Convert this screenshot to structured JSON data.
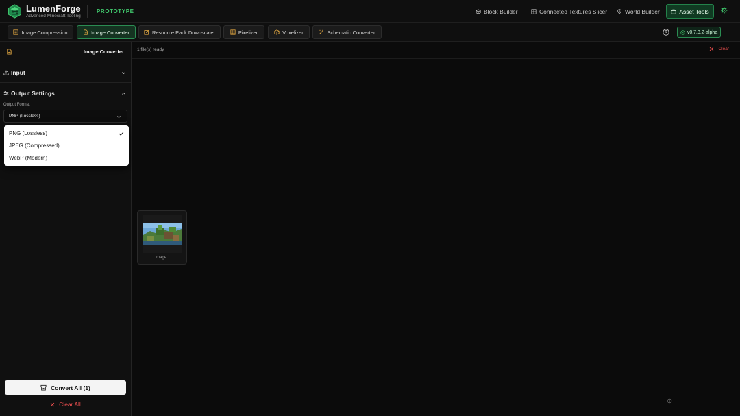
{
  "app": {
    "name": "LumenForge",
    "subtitle": "Advanced Minecraft Tooling",
    "badge": "PROTOTYPE",
    "accent_color": "#3fc36a"
  },
  "top_nav": {
    "links": [
      {
        "label": "Block Builder",
        "icon": "cube-stack-icon"
      },
      {
        "label": "Connected Textures Slicer",
        "icon": "grid-icon"
      },
      {
        "label": "World Builder",
        "icon": "map-pin-icon"
      }
    ],
    "asset_tools": {
      "label": "Asset Tools",
      "icon": "toolbox-icon"
    },
    "settings_icon": "gear-icon"
  },
  "tabs": [
    {
      "label": "Image Compression",
      "icon": "image-compress-icon",
      "active": false
    },
    {
      "label": "Image Converter",
      "icon": "file-convert-icon",
      "active": true
    },
    {
      "label": "Resource Pack Downscaler",
      "icon": "edit-icon",
      "active": false
    },
    {
      "label": "Pixelizer",
      "icon": "pixel-grid-icon",
      "active": false
    },
    {
      "label": "Voxelizer",
      "icon": "box-icon",
      "active": false
    },
    {
      "label": "Schematic Converter",
      "icon": "wand-icon",
      "active": false
    }
  ],
  "version": "v0.7.3.2-alpha",
  "sidebar": {
    "title": "Image Converter",
    "sections": {
      "input": {
        "label": "Input",
        "expanded": false
      },
      "output": {
        "label": "Output Settings",
        "expanded": true
      }
    },
    "output_format": {
      "label": "Output Format",
      "selected": "PNG (Lossless)",
      "options": [
        "PNG (Lossless)",
        "JPEG (Compressed)",
        "WebP (Modern)"
      ]
    },
    "convert_button": "Convert All (1)",
    "clear_all_button": "Clear All"
  },
  "main": {
    "status": "1 file(s) ready",
    "clear_label": "Clear",
    "files": [
      {
        "caption": "image 1"
      }
    ]
  },
  "colors": {
    "danger": "#ef5050",
    "active_tab_bg": "#153321",
    "active_tab_border": "#2b8c52"
  }
}
